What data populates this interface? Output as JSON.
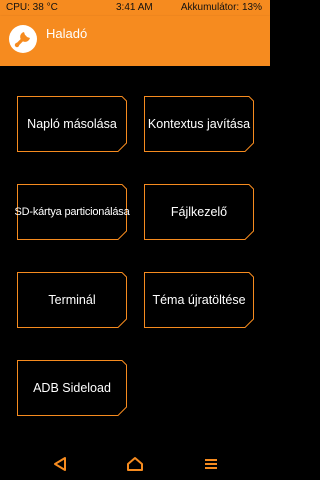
{
  "status": {
    "cpu": "CPU: 38 °C",
    "time": "3:41 AM",
    "battery": "Akkumulátor: 13%"
  },
  "header": {
    "title": "Haladó"
  },
  "buttons": [
    {
      "label": "Napló másolása"
    },
    {
      "label": "Kontextus javítása"
    },
    {
      "label": "SD-kártya particionálása"
    },
    {
      "label": "Fájlkezelő"
    },
    {
      "label": "Terminál"
    },
    {
      "label": "Téma újratöltése"
    },
    {
      "label": "ADB Sideload"
    }
  ],
  "nav": {
    "back_icon": "back-triangle-icon",
    "home_icon": "home-icon",
    "menu_icon": "menu-icon"
  },
  "colors": {
    "accent": "#f68b1f",
    "background": "#000000"
  }
}
